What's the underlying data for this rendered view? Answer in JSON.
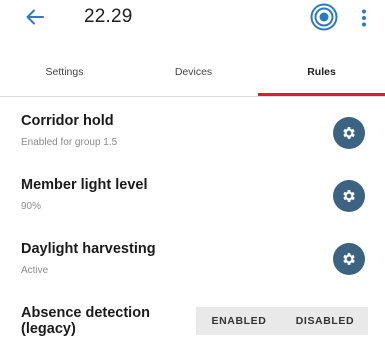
{
  "appbar": {
    "back_icon": "arrow-left-icon",
    "title": "22.29",
    "target_icon": "target-icon",
    "more_icon": "more-vertical-icon"
  },
  "tabs": [
    {
      "label": "Settings",
      "active": false
    },
    {
      "label": "Devices",
      "active": false
    },
    {
      "label": "Rules",
      "active": true
    }
  ],
  "colors": {
    "accent": "#d62030",
    "gear_button": "#3d6382",
    "target_icon": "#2b7bbf"
  },
  "rules": [
    {
      "title": "Corridor hold",
      "subtitle": "Enabled for group 1.5",
      "action_icon": "gear-icon"
    },
    {
      "title": "Member light level",
      "subtitle": "90%",
      "action_icon": "gear-icon"
    },
    {
      "title": "Daylight harvesting",
      "subtitle": "Active",
      "action_icon": "gear-icon"
    },
    {
      "title_line1": "Absence detection",
      "title_line2": "(legacy)",
      "options": [
        "ENABLED",
        "DISABLED"
      ]
    }
  ]
}
